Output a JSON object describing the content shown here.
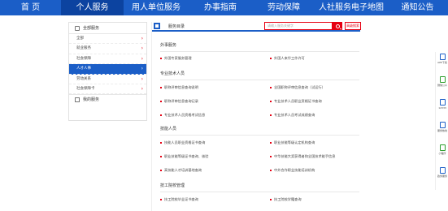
{
  "nav": {
    "items": [
      "首 页",
      "个人服务",
      "用人单位服务",
      "办事指南",
      "劳动保障",
      "人社服务电子地图",
      "通知公告"
    ],
    "active_index": 1
  },
  "sidebar": {
    "header": "全部服务",
    "items": [
      "全部",
      "就业服务",
      "社会保障",
      "人才人事",
      "劳动关系",
      "社会保障卡"
    ],
    "active_index": 3,
    "footer": "我的服务"
  },
  "main": {
    "header_title": "服务目录",
    "search_placeholder": "请输入服务关键字",
    "advanced_label": "高级搜索",
    "sections": [
      {
        "title": "外事服务",
        "links": [
          "外国专家服务管理",
          "外国人来华工作许可"
        ]
      },
      {
        "title": "专业技术人员",
        "links": [
          "职称评审信息查询说明",
          "全国职称评审信息查询（试运行）",
          "职称评审信息查询记录",
          "专业技术人员职业资格证书查询",
          "专业技术人员资格考试信息",
          "专业技术人员考试成绩查询"
        ]
      },
      {
        "title": "技能人员",
        "links": [
          "技能人员职业资格证书查询",
          "职业技能等级认定机构查询",
          "职业技能等级证书查询、核验",
          "中华技能大奖获得者和全国技术能手信息",
          "高技能人才培训基地查询",
          "中外合作职业技能培训机构"
        ]
      },
      {
        "title": "技工院校管理",
        "links": [
          "技工院校毕业证书查询",
          "技工院校学籍查询"
        ]
      }
    ]
  },
  "rightbar": {
    "items": [
      "APP下载",
      "微信公众号",
      "12333",
      "服务热线",
      "小程序",
      "政务服务"
    ]
  },
  "colors": {
    "primary": "#1b5ec7",
    "accent": "#e60012"
  }
}
